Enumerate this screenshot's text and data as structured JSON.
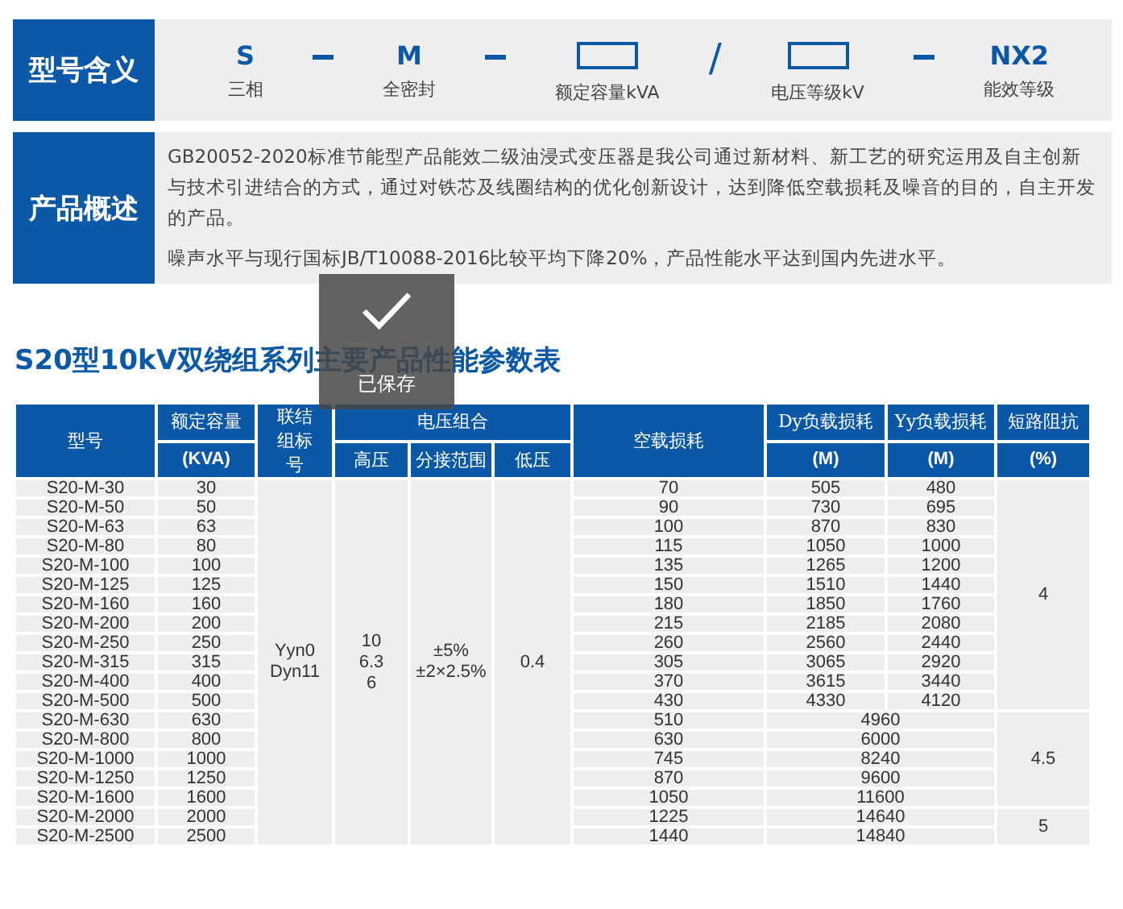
{
  "model_meaning": {
    "heading": "型号含义",
    "parts": [
      {
        "kind": "code",
        "text": "S",
        "label": "三相"
      },
      {
        "kind": "dash"
      },
      {
        "kind": "code",
        "text": "M",
        "label": "全密封"
      },
      {
        "kind": "dash"
      },
      {
        "kind": "box",
        "label": "额定容量kVA"
      },
      {
        "kind": "slash",
        "text": "/"
      },
      {
        "kind": "box",
        "label": "电压等级kV"
      },
      {
        "kind": "dash"
      },
      {
        "kind": "code",
        "text": "NX2",
        "label": "能效等级"
      }
    ]
  },
  "overview": {
    "heading": "产品概述",
    "paragraphs": [
      "GB20052-2020标准节能型产品能效二级油浸式变压器是我公司通过新材料、新工艺的研究运用及自主创新与技术引进结合的方式，通过对铁芯及线圈结构的优化创新设计，达到降低空载损耗及噪音的目的，自主开发的产品。",
      "噪声水平与现行国标JB/T10088-2016比较平均下降20%，产品性能水平达到国内先进水平。"
    ]
  },
  "table_title": "S20型10kV双绕组系列主要产品性能参数表",
  "table": {
    "header_top": [
      "型号",
      "额定容量",
      "联结组标号",
      "电压组合",
      "空载损耗",
      "Dy负载损耗",
      "Yy负载损耗",
      "短路阻抗"
    ],
    "header_bottom": [
      "(KVA)",
      "高压",
      "分接范围",
      "低压",
      "(M)",
      "(M)",
      "(%)"
    ],
    "connection": [
      "Yyn0",
      "Dyn11"
    ],
    "high_voltage": [
      "10",
      "6.3",
      "6"
    ],
    "tap_range": [
      "±5%",
      "±2×2.5%"
    ],
    "low_voltage": "0.4",
    "groups": [
      {
        "impedance": "4",
        "rows": [
          {
            "kind": "split",
            "model": "S20-M-30",
            "capacity": "30",
            "no_load": "70",
            "dy_load": "505",
            "yy_load": "480"
          },
          {
            "kind": "split",
            "model": "S20-M-50",
            "capacity": "50",
            "no_load": "90",
            "dy_load": "730",
            "yy_load": "695"
          },
          {
            "kind": "split",
            "model": "S20-M-63",
            "capacity": "63",
            "no_load": "100",
            "dy_load": "870",
            "yy_load": "830"
          },
          {
            "kind": "split",
            "model": "S20-M-80",
            "capacity": "80",
            "no_load": "115",
            "dy_load": "1050",
            "yy_load": "1000"
          },
          {
            "kind": "split",
            "model": "S20-M-100",
            "capacity": "100",
            "no_load": "135",
            "dy_load": "1265",
            "yy_load": "1200"
          },
          {
            "kind": "split",
            "model": "S20-M-125",
            "capacity": "125",
            "no_load": "150",
            "dy_load": "1510",
            "yy_load": "1440"
          },
          {
            "kind": "split",
            "model": "S20-M-160",
            "capacity": "160",
            "no_load": "180",
            "dy_load": "1850",
            "yy_load": "1760"
          },
          {
            "kind": "split",
            "model": "S20-M-200",
            "capacity": "200",
            "no_load": "215",
            "dy_load": "2185",
            "yy_load": "2080"
          },
          {
            "kind": "split",
            "model": "S20-M-250",
            "capacity": "250",
            "no_load": "260",
            "dy_load": "2560",
            "yy_load": "2440"
          },
          {
            "kind": "split",
            "model": "S20-M-315",
            "capacity": "315",
            "no_load": "305",
            "dy_load": "3065",
            "yy_load": "2920"
          },
          {
            "kind": "split",
            "model": "S20-M-400",
            "capacity": "400",
            "no_load": "370",
            "dy_load": "3615",
            "yy_load": "3440"
          },
          {
            "kind": "split",
            "model": "S20-M-500",
            "capacity": "500",
            "no_load": "430",
            "dy_load": "4330",
            "yy_load": "4120"
          }
        ]
      },
      {
        "impedance": "4.5",
        "rows": [
          {
            "kind": "merged",
            "model": "S20-M-630",
            "capacity": "630",
            "no_load": "510",
            "load": "4960"
          },
          {
            "kind": "merged",
            "model": "S20-M-800",
            "capacity": "800",
            "no_load": "630",
            "load": "6000"
          },
          {
            "kind": "merged",
            "model": "S20-M-1000",
            "capacity": "1000",
            "no_load": "745",
            "load": "8240"
          },
          {
            "kind": "merged",
            "model": "S20-M-1250",
            "capacity": "1250",
            "no_load": "870",
            "load": "9600"
          },
          {
            "kind": "merged",
            "model": "S20-M-1600",
            "capacity": "1600",
            "no_load": "1050",
            "load": "11600"
          }
        ]
      },
      {
        "impedance": "5",
        "rows": [
          {
            "kind": "merged",
            "model": "S20-M-2000",
            "capacity": "2000",
            "no_load": "1225",
            "load": "14640"
          },
          {
            "kind": "merged",
            "model": "S20-M-2500",
            "capacity": "2500",
            "no_load": "1440",
            "load": "14840"
          }
        ]
      }
    ]
  },
  "toast": {
    "text": "已保存"
  }
}
